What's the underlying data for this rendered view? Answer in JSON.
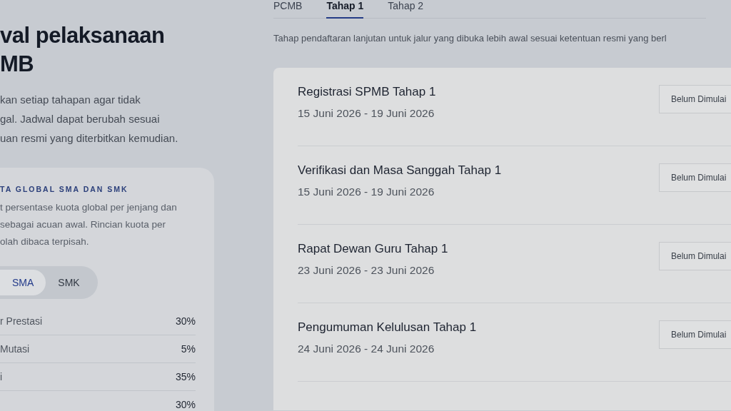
{
  "intro": {
    "heading_lines": [
      "val pelaksanaan",
      "MB"
    ],
    "text_lines": [
      "kan setiap tahapan agar tidak",
      "gal. Jadwal dapat berubah sesuai",
      "uan resmi yang diterbitkan kemudian."
    ]
  },
  "quota_card": {
    "title": "TA GLOBAL SMA DAN SMK",
    "text_lines": [
      "t persentase kuota global per jenjang dan",
      "sebagai acuan awal. Rincian kuota per",
      "olah dibaca terpisah."
    ],
    "segments": [
      {
        "label": "SMA",
        "selected": true
      },
      {
        "label": "SMK",
        "selected": false
      }
    ],
    "rows": [
      {
        "label": "r Prestasi",
        "value": "30%"
      },
      {
        "label": "Mutasi",
        "value": "5%"
      },
      {
        "label": "i",
        "value": "35%"
      },
      {
        "value": "30%"
      }
    ]
  },
  "tabs": [
    {
      "label": "PCMB",
      "selected": false
    },
    {
      "label": "Tahap 1",
      "selected": true
    },
    {
      "label": "Tahap 2",
      "selected": false
    }
  ],
  "description": "Tahap pendaftaran lanjutan untuk jalur yang dibuka lebih awal sesuai ketentuan resmi yang berl",
  "schedule": [
    {
      "title": "Registrasi SPMB Tahap 1",
      "dates": "15 Juni 2026 - 19 Juni 2026",
      "status": "Belum Dimulai"
    },
    {
      "title": "Verifikasi dan Masa Sanggah Tahap 1",
      "dates": "15 Juni 2026 - 19 Juni 2026",
      "status": "Belum Dimulai"
    },
    {
      "title": "Rapat Dewan Guru Tahap 1",
      "dates": "23 Juni 2026 - 23 Juni 2026",
      "status": "Belum Dimulai"
    },
    {
      "title": "Pengumuman Kelulusan Tahap 1",
      "dates": "24 Juni 2026 - 24 Juni 2026",
      "status": "Belum Dimulai"
    }
  ]
}
